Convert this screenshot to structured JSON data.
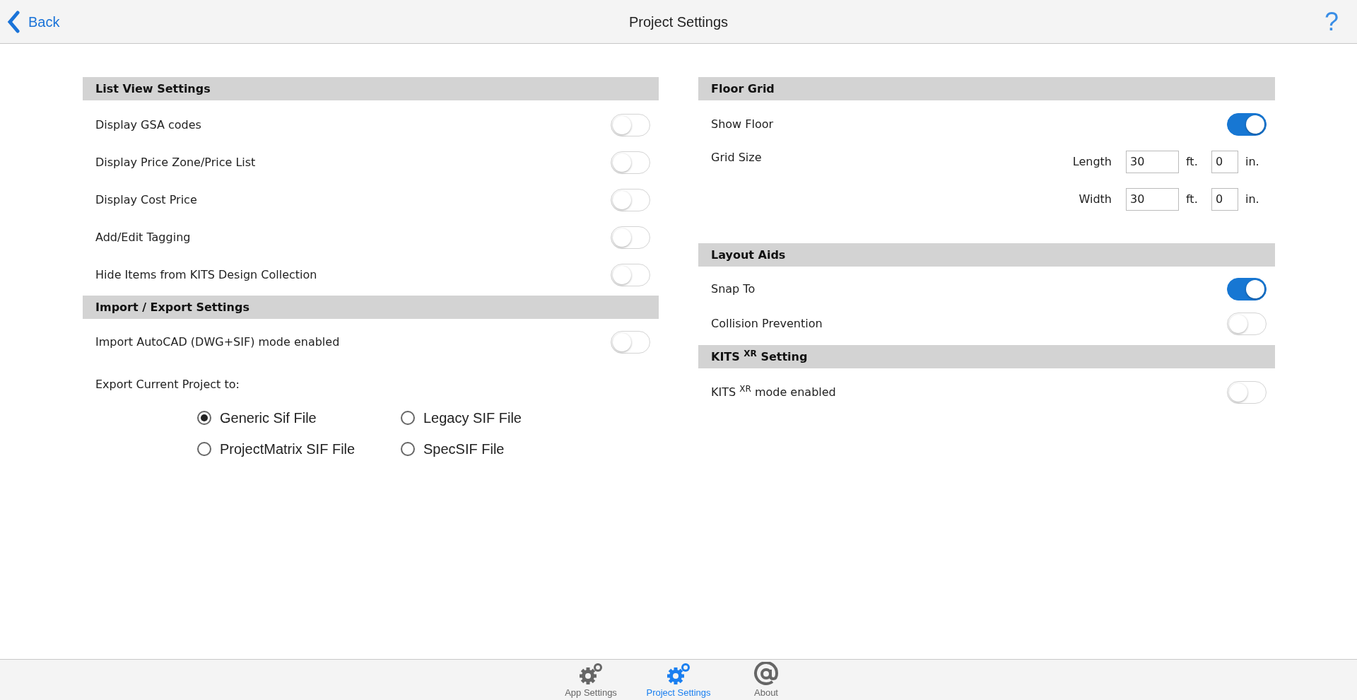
{
  "header": {
    "back": "Back",
    "title": "Project Settings",
    "help": "?"
  },
  "list_view": {
    "title": "List View Settings",
    "toggles": [
      {
        "label": "Display GSA codes",
        "on": false
      },
      {
        "label": "Display Price Zone/Price List",
        "on": false
      },
      {
        "label": "Display Cost Price",
        "on": false
      },
      {
        "label": "Add/Edit Tagging",
        "on": false
      },
      {
        "label": "Hide Items from KITS Design Collection",
        "on": false
      }
    ]
  },
  "import_export": {
    "title": "Import / Export Settings",
    "toggles": [
      {
        "label": "Import AutoCAD (DWG+SIF) mode enabled",
        "on": false
      }
    ],
    "export_label": "Export Current Project to:",
    "options": [
      {
        "label": "Generic Sif File",
        "selected": true
      },
      {
        "label": "Legacy SIF File",
        "selected": false
      },
      {
        "label": "ProjectMatrix SIF File",
        "selected": false
      },
      {
        "label": "SpecSIF File",
        "selected": false
      }
    ]
  },
  "floor_grid": {
    "title": "Floor Grid",
    "toggles": [
      {
        "label": "Show Floor",
        "on": true
      }
    ],
    "grid_size": {
      "label": "Grid Size",
      "rows": [
        {
          "label": "Length",
          "feet": "30",
          "feet_unit": "ft.",
          "inches": "0",
          "inches_unit": "in."
        },
        {
          "label": "Width",
          "feet": "30",
          "feet_unit": "ft.",
          "inches": "0",
          "inches_unit": "in."
        }
      ]
    }
  },
  "layout_aids": {
    "title": "Layout Aids",
    "toggles": [
      {
        "label": "Snap To",
        "on": true
      },
      {
        "label": "Collision Prevention",
        "on": false
      }
    ]
  },
  "kits_xr": {
    "title": "KITS $^{XR}$ Setting",
    "toggles": [
      {
        "label": "KITS $^{XR}$ mode enabled",
        "on": false
      }
    ]
  },
  "tabs": [
    {
      "label": "App Settings",
      "kind": "gears",
      "selected": false
    },
    {
      "label": "Project Settings",
      "kind": "gears",
      "selected": true
    },
    {
      "label": "About",
      "kind": "at",
      "selected": false
    }
  ]
}
